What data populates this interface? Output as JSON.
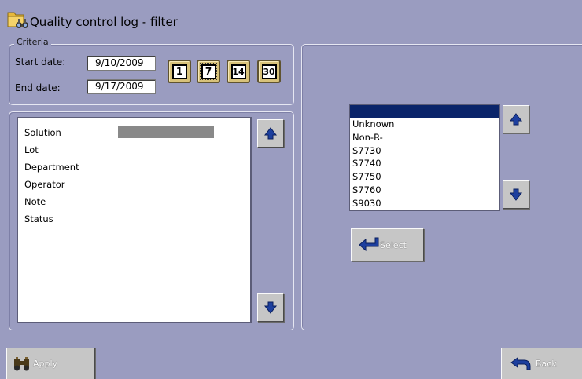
{
  "window": {
    "title": "Quality control log - filter",
    "title_icon": "folder-binoculars-icon"
  },
  "criteria": {
    "legend": "Criteria",
    "start_label": "Start date:",
    "start_value": "9/10/2009",
    "end_label": "End date:",
    "end_value": "9/17/2009",
    "day_buttons": [
      "1",
      "7",
      "14",
      "30"
    ],
    "selected_days": "7"
  },
  "criteria_list": {
    "items": [
      "Solution",
      "Lot",
      "Department",
      "Operator",
      "Note",
      "Status"
    ]
  },
  "values_list": {
    "items": [
      "Unknown",
      "Non-R-",
      "S7730",
      "S7740",
      "S7750",
      "S7760",
      "S9030"
    ]
  },
  "buttons": {
    "select_label": "Select",
    "apply_label": "Apply",
    "back_label": "Back"
  },
  "colors": {
    "background": "#9a9cc0",
    "selection": "#0a246a",
    "arrow": "#1d3f9e",
    "day_button": "#d8c27a"
  }
}
